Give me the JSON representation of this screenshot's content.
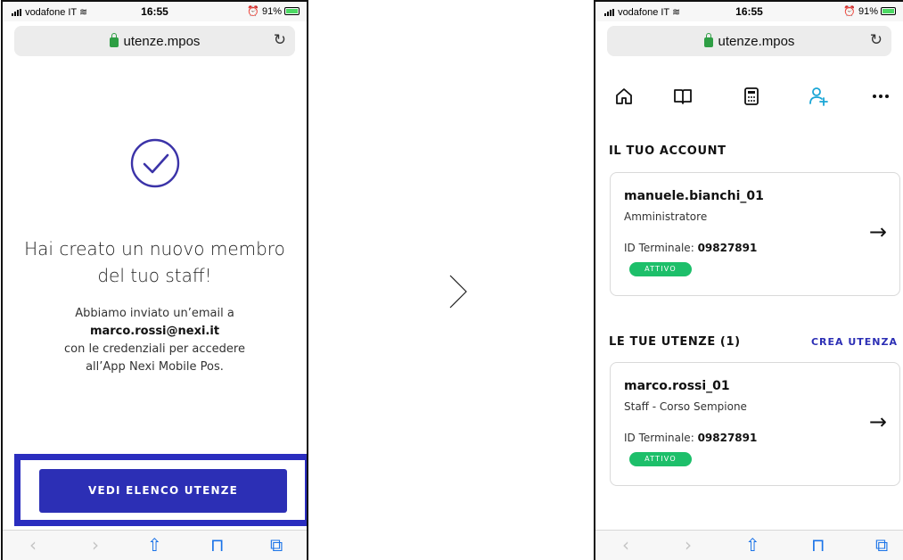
{
  "left_screen": {
    "status": {
      "carrier": "vodafone IT",
      "time": "16:55",
      "battery": "91%"
    },
    "url": "utenze.mpos",
    "title": "Hai creato un nuovo membro del tuo staff!",
    "body_line1": "Abbiamo inviato un’email a",
    "body_email": "marco.rossi@nexi.it",
    "body_line3": "con le credenziali per accedere",
    "body_line4": "all’App Nexi Mobile Pos.",
    "cta_label": "VEDI ELENCO UTENZE"
  },
  "right_screen": {
    "status": {
      "carrier": "vodafone IT",
      "time": "16:55",
      "battery": "91%"
    },
    "url": "utenze.mpos",
    "nav_icons": [
      "home-icon",
      "book-icon",
      "calculator-icon",
      "add-user-icon",
      "more-icon"
    ],
    "account_section_label": "IL TUO ACCOUNT",
    "account_card": {
      "username": "manuele.bianchi_01",
      "role": "Amministratore",
      "terminal_label": "ID Terminale:",
      "terminal_id": "09827891",
      "status": "ATTIVO"
    },
    "users_section_label": "LE TUE UTENZE (1)",
    "create_user_label": "CREA UTENZA",
    "user_card": {
      "username": "marco.rossi_01",
      "role": "Staff - Corso Sempione",
      "terminal_label": "ID Terminale:",
      "terminal_id": "09827891",
      "status": "ATTIVO"
    }
  },
  "colors": {
    "primary": "#2c2fb5",
    "active_badge": "#1dbf6a",
    "lock": "#2e9e44"
  }
}
